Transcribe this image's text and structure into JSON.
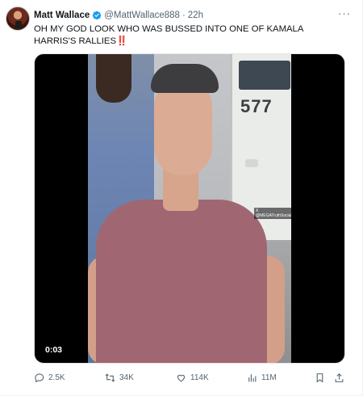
{
  "tweet": {
    "author_name": "Matt Wallace",
    "author_handle": "@MattWallace888",
    "separator": "·",
    "time": "22h",
    "more_label": "···",
    "text": "OH MY GOD LOOK WHO WAS BUSSED INTO ONE OF KAMALA HARRIS'S RALLIES",
    "text_emoji": "‼️",
    "verified": true
  },
  "media": {
    "type": "video",
    "duration": "0:03",
    "bus_number": "577",
    "watermark_text": "X @MEGATruthSocial"
  },
  "actions": {
    "replies": "2.5K",
    "reposts": "34K",
    "likes": "114K",
    "views": "11M"
  },
  "colors": {
    "verified_blue": "#1d9bf0",
    "secondary_text": "#536471",
    "primary_text": "#0f1419"
  },
  "icons": {
    "reply": "reply-icon",
    "repost": "repost-icon",
    "like": "like-icon",
    "views": "views-icon",
    "bookmark": "bookmark-icon",
    "share": "share-icon",
    "verified": "verified-badge-icon",
    "more": "more-icon"
  }
}
